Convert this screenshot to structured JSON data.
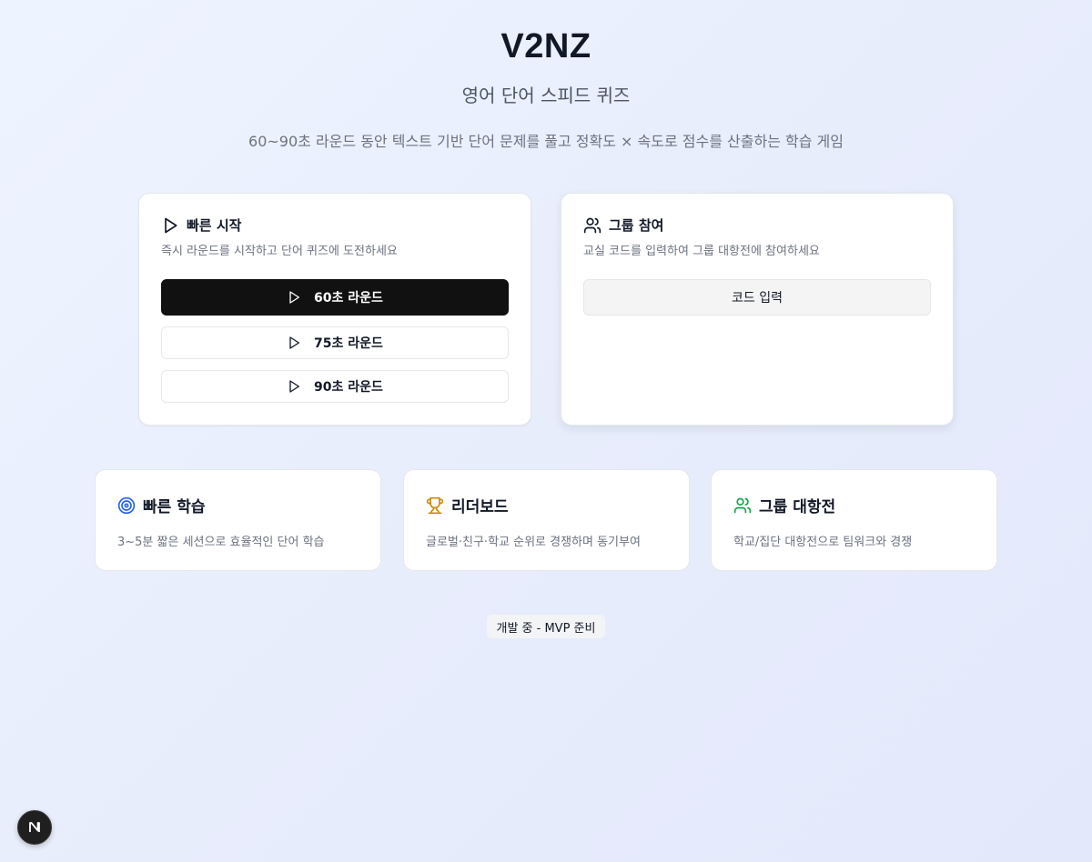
{
  "header": {
    "title": "V2NZ",
    "subtitle": "영어 단어 스피드 퀴즈",
    "description": "60~90초 라운드 동안 텍스트 기반 단어 문제를 풀고 정확도 × 속도로 점수를 산출하는 학습 게임"
  },
  "quick_start": {
    "icon": "play-icon",
    "title": "빠른 시작",
    "description": "즉시 라운드를 시작하고 단어 퀴즈에 도전하세요",
    "buttons": [
      {
        "label": "60초 라운드",
        "icon": "play-icon",
        "primary": true
      },
      {
        "label": "75초 라운드",
        "icon": "play-icon"
      },
      {
        "label": "90초 라운드",
        "icon": "play-icon"
      }
    ]
  },
  "group_join": {
    "icon": "users-icon",
    "title": "그룹 참여",
    "description": "교실 코드를 입력하여 그룹 대항전에 참여하세요",
    "button_label": "코드 입력"
  },
  "features": [
    {
      "icon": "target-icon",
      "title": "빠른 학습",
      "description": "3~5분 짧은 세션으로 효율적인 단어 학습",
      "color": "#2563eb"
    },
    {
      "icon": "trophy-icon",
      "title": "리더보드",
      "description": "글로벌·친구·학교 순위로 경쟁하며 동기부여",
      "color": "#ca8a04"
    },
    {
      "icon": "users-icon",
      "title": "그룹 대항전",
      "description": "학교/집단 대항전으로 팀워크와 경쟁",
      "color": "#16a34a"
    }
  ],
  "status_badge": "개발 중 - MVP 준비",
  "dev_indicator": "N"
}
